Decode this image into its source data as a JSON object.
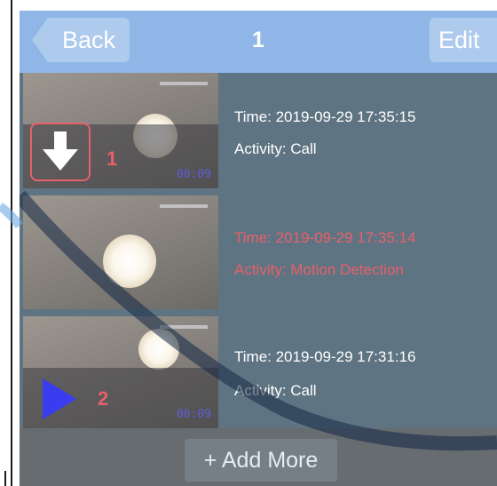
{
  "navbar": {
    "back_label": "Back",
    "title": "1",
    "edit_label": "Edit"
  },
  "recordings": [
    {
      "time": "Time: 2019-09-29 17:35:15",
      "activity": "Activity: Call",
      "duration": "00:09",
      "badge": "1",
      "icon": "download-arrow-icon",
      "text_color": "#ffffff"
    },
    {
      "time": "Time: 2019-09-29 17:35:14",
      "activity": "Activity: Motion Detection",
      "duration": "",
      "badge": "",
      "icon": "",
      "text_color": "#e8606a"
    },
    {
      "time": "Time: 2019-09-29 17:31:16",
      "activity": "Activity: Call",
      "duration": "00:09",
      "badge": "2",
      "icon": "play-icon",
      "text_color": "#ffffff"
    }
  ],
  "footer": {
    "add_more_label": "+ Add More"
  },
  "colors": {
    "navbar": "#8fb6e6",
    "highlight_red": "#e8606a",
    "play_blue": "#3a3cf0"
  }
}
